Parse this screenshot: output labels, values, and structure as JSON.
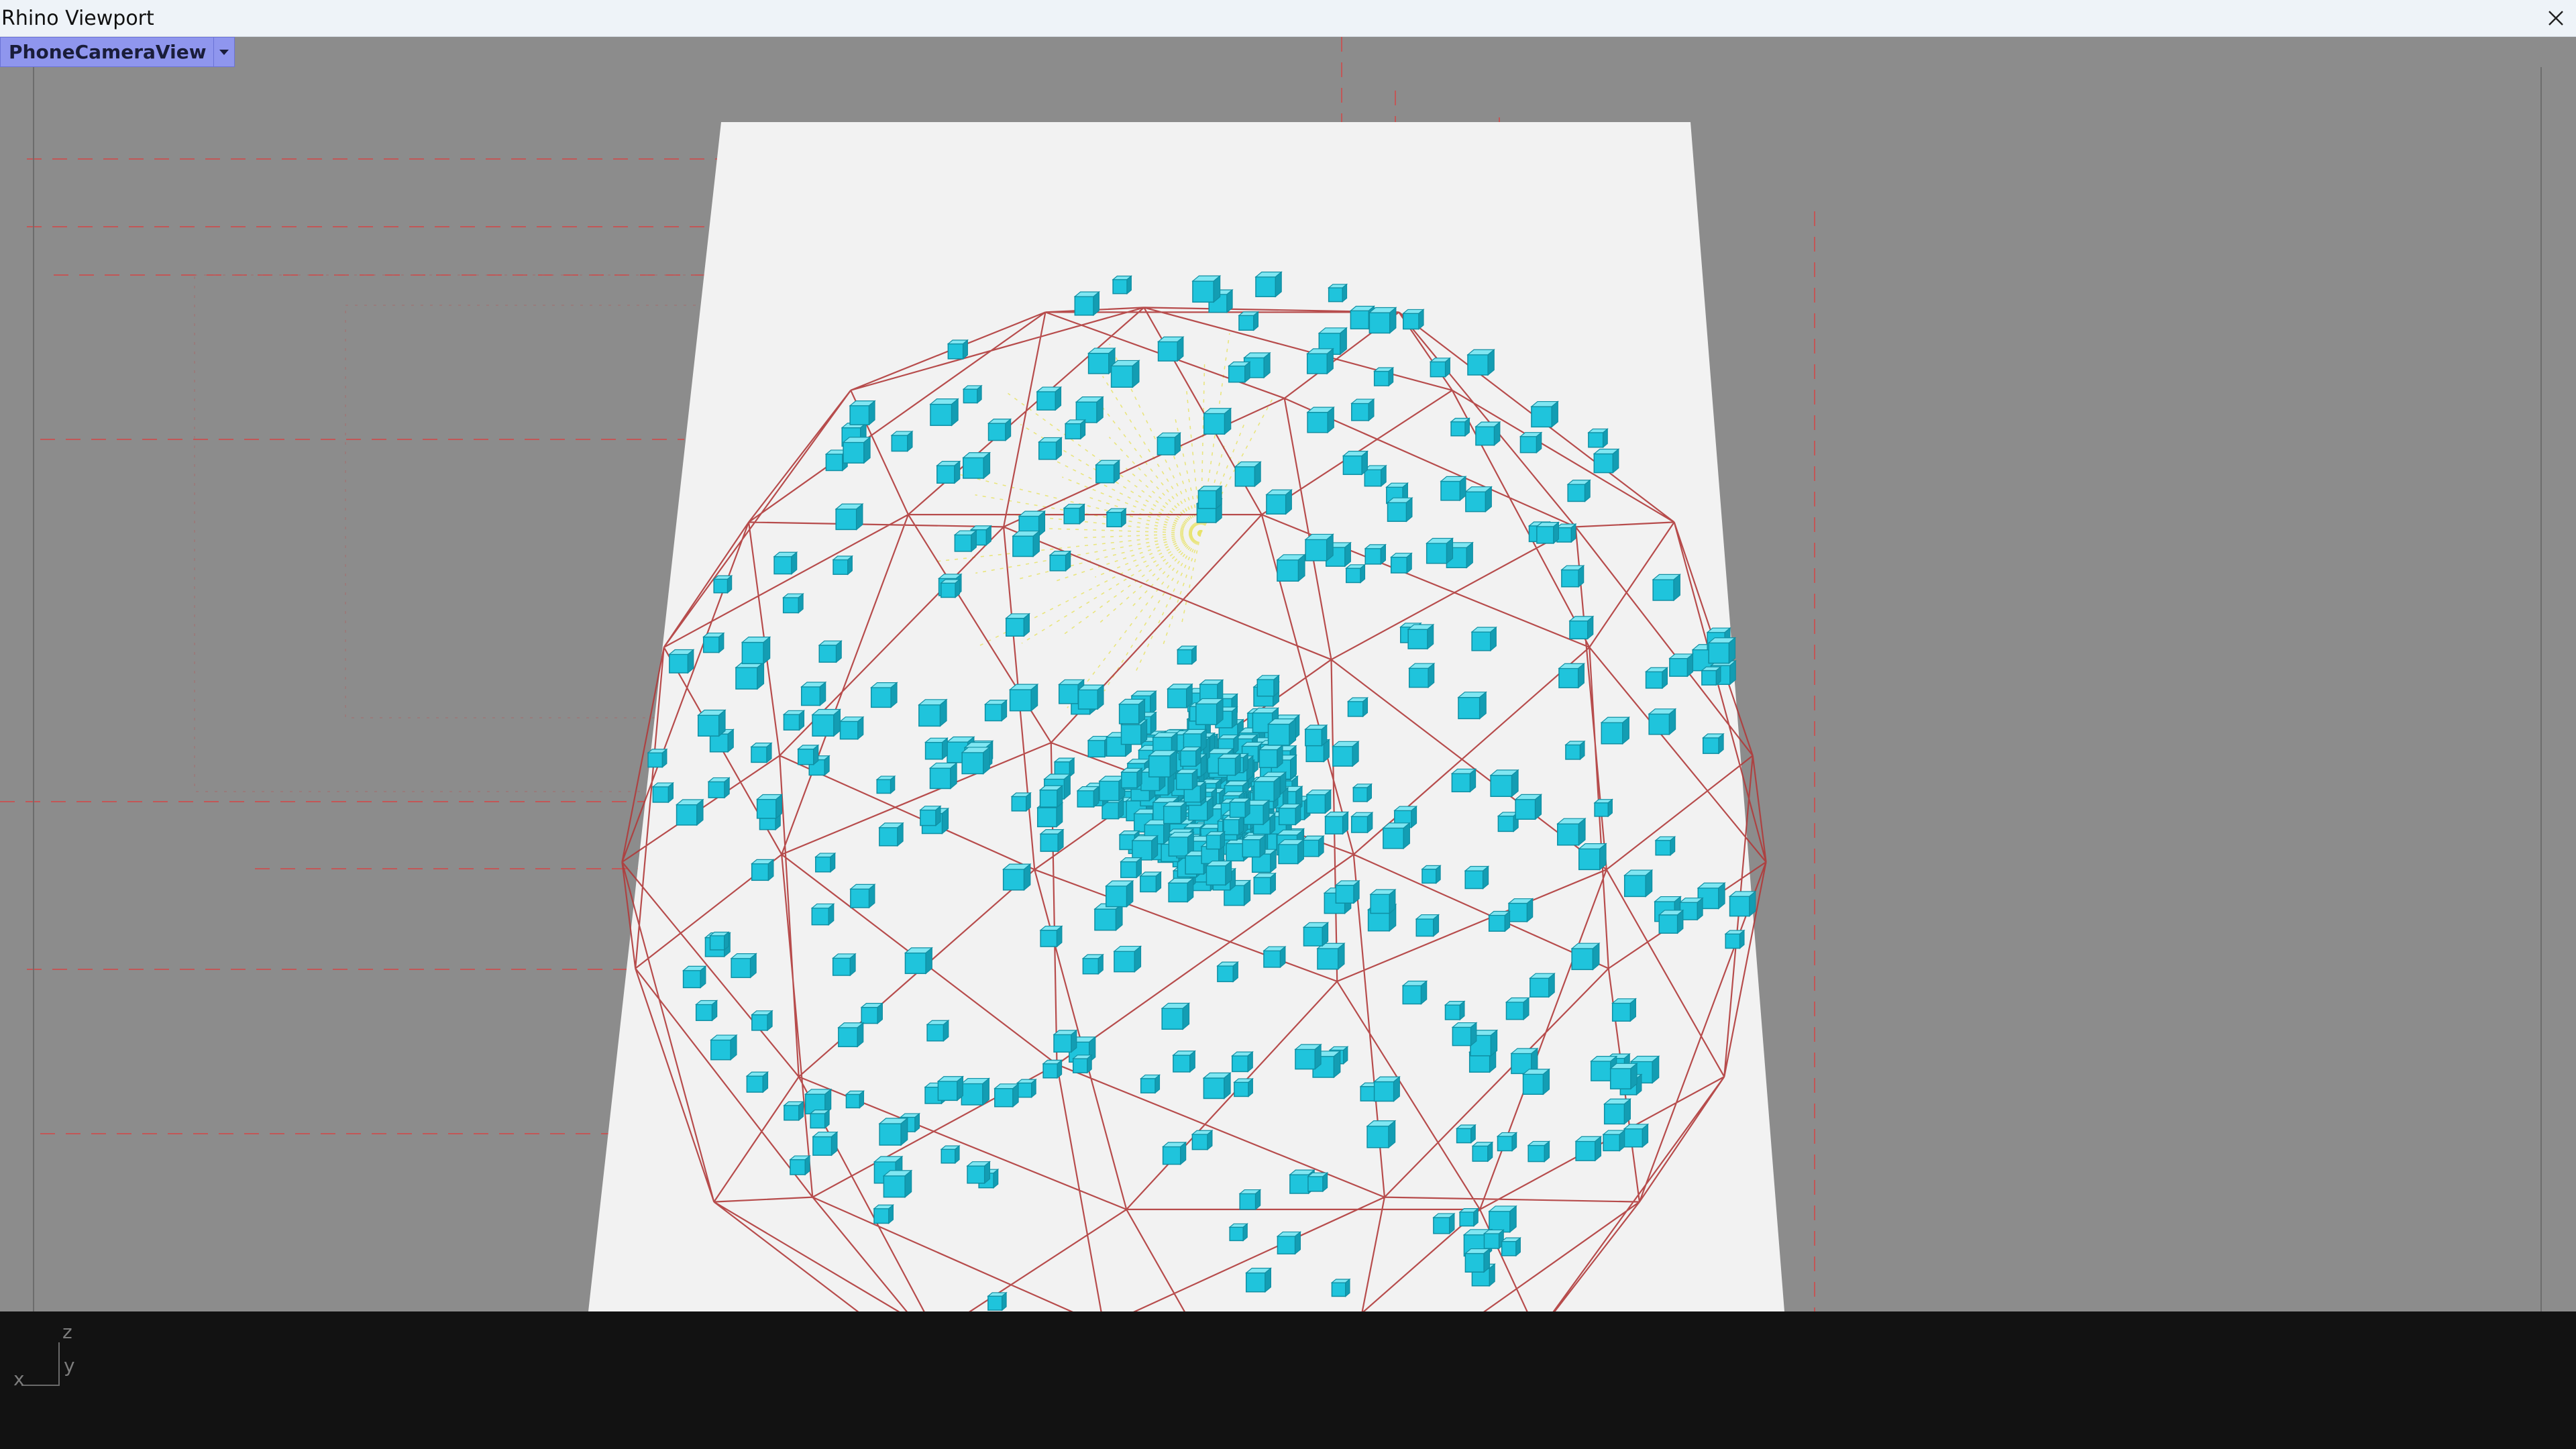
{
  "window": {
    "title": "Rhino Viewport",
    "close_icon": "close-icon"
  },
  "viewport": {
    "name": "PhoneCameraView",
    "dropdown_icon": "chevron-down-icon",
    "background_color": "#8c8c8c",
    "plane_color": "#f2f2f2",
    "mesh_color": "#b03a3a",
    "point_color": "#1fc4dc",
    "guide_color": "#d94040"
  },
  "axes": {
    "x_label": "x",
    "y_label": "y",
    "z_label": "z"
  }
}
